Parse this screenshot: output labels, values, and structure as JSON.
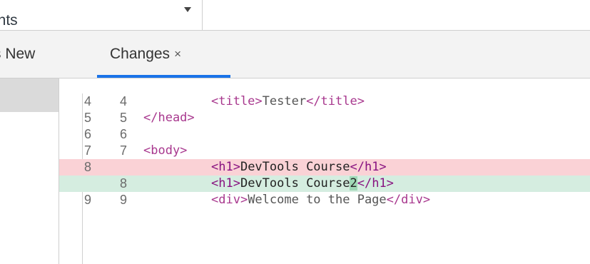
{
  "top": {
    "dropdown_label": "ints",
    "dropdown_icon": "chevron-down-icon"
  },
  "tabs": [
    {
      "label": "s New"
    },
    {
      "label": "Changes",
      "close": "×",
      "active": true
    }
  ],
  "colors": {
    "accent": "#1a73e8",
    "removed_bg": "#fad2d6",
    "added_bg": "#d5ede0",
    "changed_char_bg": "#9fd8b6",
    "tag_color": "#881280"
  },
  "diff": {
    "rows": [
      {
        "old": "4",
        "new": "4",
        "type": "context",
        "indent": true,
        "tag_open": "<title>",
        "text": "Tester",
        "tag_close": "</title>",
        "changed": ""
      },
      {
        "old": "5",
        "new": "5",
        "type": "context",
        "indent": false,
        "tag_open": "</head>",
        "text": "",
        "tag_close": "",
        "changed": ""
      },
      {
        "old": "6",
        "new": "6",
        "type": "context",
        "indent": false,
        "tag_open": "",
        "text": "",
        "tag_close": "",
        "changed": ""
      },
      {
        "old": "7",
        "new": "7",
        "type": "context",
        "indent": false,
        "tag_open": "<body>",
        "text": "",
        "tag_close": "",
        "changed": ""
      },
      {
        "old": "8",
        "new": "",
        "type": "removed",
        "indent": true,
        "tag_open": "<h1>",
        "text": "DevTools Course",
        "tag_close": "</h1>",
        "changed": ""
      },
      {
        "old": "",
        "new": "8",
        "type": "added",
        "indent": true,
        "tag_open": "<h1>",
        "text": "DevTools Course",
        "tag_close": "</h1>",
        "changed": "2"
      },
      {
        "old": "9",
        "new": "9",
        "type": "context",
        "indent": true,
        "tag_open": "<div>",
        "text": "Welcome to the Page",
        "tag_close": "</div>",
        "changed": ""
      }
    ]
  }
}
